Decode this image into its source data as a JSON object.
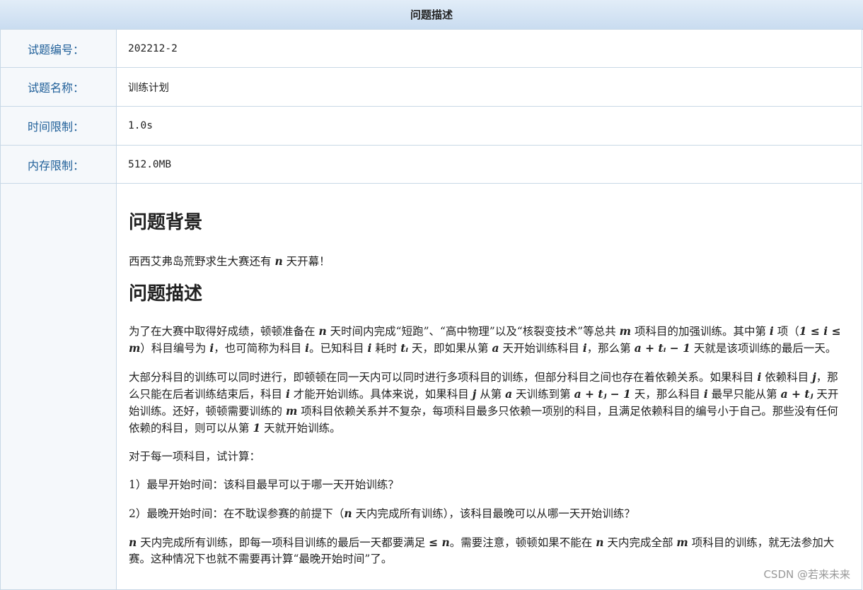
{
  "header": {
    "title": "问题描述"
  },
  "info": {
    "id_label": "试题编号：",
    "id_value": "202212-2",
    "name_label": "试题名称：",
    "name_value": "训练计划",
    "time_label": "时间限制：",
    "time_value": "1.0s",
    "mem_label": "内存限制：",
    "mem_value": "512.0MB"
  },
  "content": {
    "h_background": "问题背景",
    "bg_a": "西西艾弗岛荒野求生大赛还有 ",
    "bg_n": "n",
    "bg_b": " 天开幕！",
    "h_desc": "问题描述",
    "p1": {
      "a": "为了在大赛中取得好成绩，顿顿准备在 ",
      "n": "n",
      "b": " 天时间内完成“短跑”、“高中物理”以及“核裂变技术”等总共 ",
      "m": "m",
      "c": " 项科目的加强训练。其中第 ",
      "i1": "i",
      "d": " 项（",
      "range": "1 ≤ i ≤ m",
      "e": "）科目编号为 ",
      "i2": "i",
      "f": "，也可简称为科目 ",
      "i3": "i",
      "g": "。已知科目 ",
      "i4": "i",
      "h": " 耗时 ",
      "ti": "tᵢ",
      "j": " 天，即如果从第 ",
      "a_var": "a",
      "k": " 天开始训练科目 ",
      "i5": "i",
      "l": "，那么第 ",
      "expr": "a + tᵢ − 1",
      "m_end": " 天就是该项训练的最后一天。"
    },
    "p2": {
      "a": "大部分科目的训练可以同时进行，即顿顿在同一天内可以同时进行多项科目的训练，但部分科目之间也存在着依赖关系。如果科目 ",
      "i1": "i",
      "b": " 依赖科目 ",
      "j1": "j",
      "c": "，那么只能在后者训练结束后，科目 ",
      "i2": "i",
      "d": " 才能开始训练。具体来说，如果科目 ",
      "j2": "j",
      "e": " 从第 ",
      "a1": "a",
      "f": " 天训练到第 ",
      "expr1": "a + tⱼ − 1",
      "g": " 天，那么科目 ",
      "i3": "i",
      "h": " 最早只能从第 ",
      "expr2": "a + tⱼ",
      "k": " 天开始训练。还好，顿顿需要训练的 ",
      "m": "m",
      "l": " 项科目依赖关系并不复杂，每项科目最多只依赖一项别的科目，且满足依赖科目的编号小于自己。那些没有任何依赖的科目，则可以从第 ",
      "one": "1",
      "n_end": " 天就开始训练。"
    },
    "p3": "对于每一项科目，试计算：",
    "p4": "1）最早开始时间：该科目最早可以于哪一天开始训练？",
    "p5": {
      "a": "2）最晚开始时间：在不耽误参赛的前提下（",
      "n": "n",
      "b": " 天内完成所有训练），该科目最晚可以从哪一天开始训练？"
    },
    "p6": {
      "n1": "n",
      "a": " 天内完成所有训练，即每一项科目训练的最后一天都要满足 ",
      "le": "≤ n",
      "b": "。需要注意，顿顿如果不能在 ",
      "n2": "n",
      "c": " 天内完成全部 ",
      "m": "m",
      "d": " 项科目的训练，就无法参加大赛。这种情况下也就不需要再计算“最晚开始时间”了。"
    }
  },
  "watermark": "CSDN @若来未来"
}
